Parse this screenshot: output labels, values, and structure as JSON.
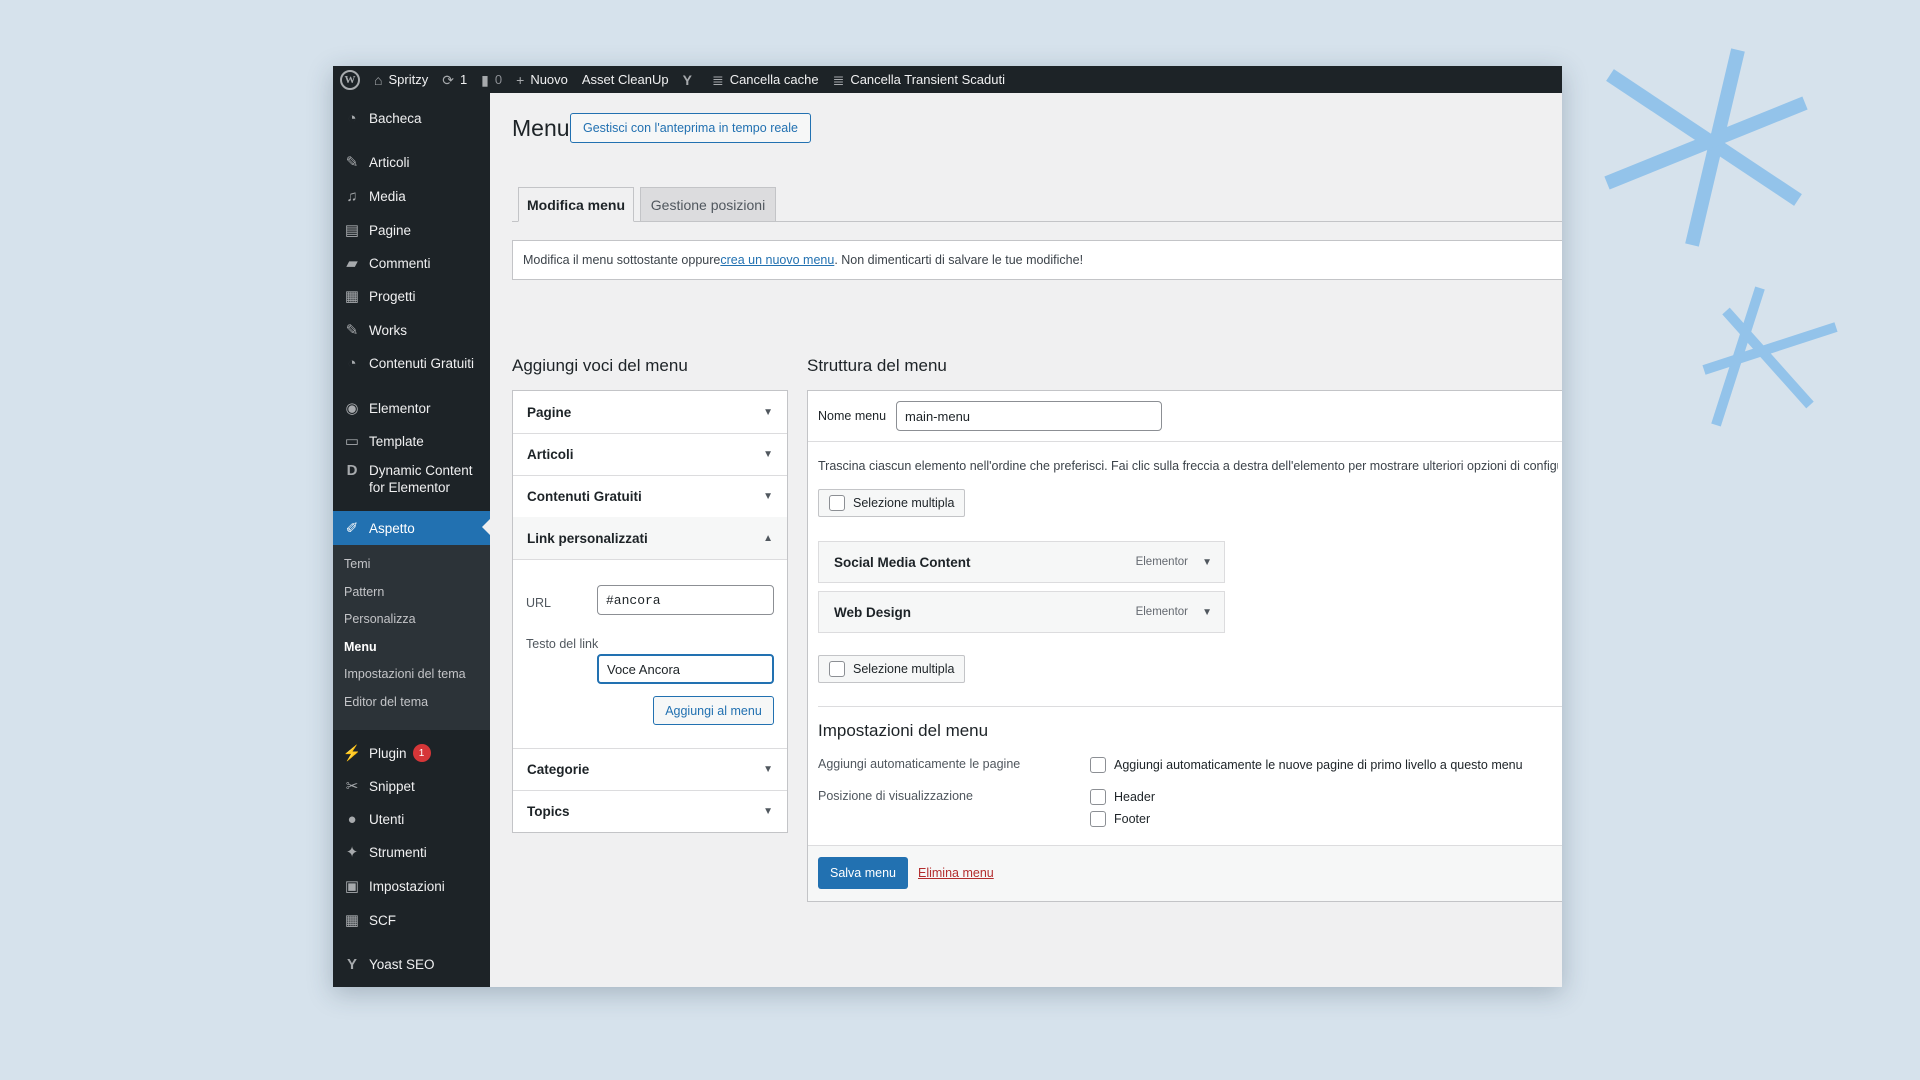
{
  "colors": {
    "accent": "#2271b1",
    "adminbar": "#1d2327",
    "danger": "#b32d2e",
    "deco": "#93c3ea"
  },
  "adminbar": {
    "site": "Spritzy",
    "updates_count": "1",
    "comments_count": "0",
    "new_label": "Nuovo",
    "asset_cleanup": "Asset CleanUp",
    "yoast_glyph": "Y",
    "clear_cache": "Cancella cache",
    "clear_transient": "Cancella Transient Scaduti"
  },
  "sidebar": {
    "items": [
      {
        "label": "Bacheca",
        "icon": "dashboard-icon"
      },
      {
        "label": "Articoli",
        "icon": "pin-icon"
      },
      {
        "label": "Media",
        "icon": "media-icon"
      },
      {
        "label": "Pagine",
        "icon": "page-icon"
      },
      {
        "label": "Commenti",
        "icon": "comment-icon"
      },
      {
        "label": "Progetti",
        "icon": "portfolio-icon"
      },
      {
        "label": "Works",
        "icon": "pin-icon"
      },
      {
        "label": "Contenuti Gratuiti",
        "icon": "dashboard-icon"
      },
      {
        "label": "Elementor",
        "icon": "elementor-icon"
      },
      {
        "label": "Template",
        "icon": "folder-icon"
      },
      {
        "label": "Dynamic Content for Elementor",
        "icon": "dce-icon"
      },
      {
        "label": "Aspetto",
        "icon": "brush-icon"
      }
    ],
    "submenu": [
      "Temi",
      "Pattern",
      "Personalizza",
      "Menu",
      "Impostazioni del tema",
      "Editor del tema"
    ],
    "items_after": [
      {
        "label": "Plugin",
        "icon": "plugin-icon",
        "badge": "1"
      },
      {
        "label": "Snippet",
        "icon": "scissors-icon"
      },
      {
        "label": "Utenti",
        "icon": "user-icon"
      },
      {
        "label": "Strumenti",
        "icon": "wrench-icon"
      },
      {
        "label": "Impostazioni",
        "icon": "settings-icon"
      },
      {
        "label": "SCF",
        "icon": "table-icon"
      },
      {
        "label": "Yoast SEO",
        "icon": "yoast-icon"
      }
    ]
  },
  "page": {
    "title": "Menu",
    "live_preview": "Gestisci con l'anteprima in tempo reale",
    "tabs": [
      "Modifica menu",
      "Gestione posizioni"
    ],
    "notice": {
      "before": "Modifica il menu sottostante oppure ",
      "link": "crea un nuovo menu",
      "after": ". Non dimenticarti di salvare le tue modifiche!"
    }
  },
  "add_items": {
    "heading": "Aggiungi voci del menu",
    "sections": [
      "Pagine",
      "Articoli",
      "Contenuti Gratuiti",
      "Link personalizzati",
      "Categorie",
      "Topics"
    ],
    "url_label": "URL",
    "url_value": "#ancora",
    "link_text_label": "Testo del link",
    "link_text_value": "Voce Ancora",
    "add_button": "Aggiungi al menu"
  },
  "structure": {
    "heading": "Struttura del menu",
    "name_label": "Nome menu",
    "name_value": "main-menu",
    "instructions": "Trascina ciascun elemento nell'ordine che preferisci. Fai clic sulla freccia a destra dell'elemento per mostrare ulteriori opzioni di configurazione.",
    "bulk_select": "Selezione multipla",
    "items": [
      {
        "title": "Social Media Content",
        "type": "Elementor"
      },
      {
        "title": "Web Design",
        "type": "Elementor"
      }
    ],
    "settings_heading": "Impostazioni del menu",
    "auto_add_label": "Aggiungi automaticamente le pagine",
    "auto_add_option": "Aggiungi automaticamente le nuove pagine di primo livello a questo menu",
    "location_label": "Posizione di visualizzazione",
    "locations": [
      "Header",
      "Footer"
    ],
    "save": "Salva menu",
    "delete": "Elimina menu"
  }
}
